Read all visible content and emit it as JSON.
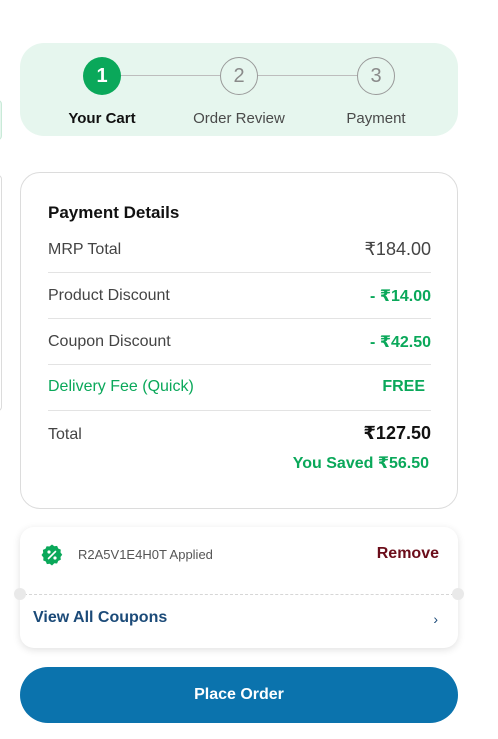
{
  "stepper": {
    "steps": [
      {
        "number": "1",
        "label": "Your Cart",
        "active": true
      },
      {
        "number": "2",
        "label": "Order Review",
        "active": false
      },
      {
        "number": "3",
        "label": "Payment",
        "active": false
      }
    ]
  },
  "payment": {
    "title": "Payment Details",
    "mrp_label": "MRP Total",
    "mrp_value": "₹184.00",
    "product_discount_label": "Product Discount",
    "product_discount_value": "- ₹14.00",
    "coupon_discount_label": "Coupon Discount",
    "coupon_discount_value": "- ₹42.50",
    "delivery_label": "Delivery Fee (Quick)",
    "delivery_value": "FREE",
    "total_label": "Total",
    "total_value": "₹127.50",
    "saved_text": "You Saved ₹56.50"
  },
  "coupon": {
    "icon": "discount-badge-icon",
    "applied_text": "R2A5V1E4H0T Applied",
    "remove_label": "Remove",
    "view_all_label": "View All Coupons",
    "chevron": "›"
  },
  "actions": {
    "place_order_label": "Place Order"
  },
  "colors": {
    "accent_green": "#0aa85a",
    "stepper_bg": "#e6f6ee",
    "primary_button": "#0b73ad",
    "remove_color": "#6b0d1a",
    "link_color": "#1b4a78"
  }
}
